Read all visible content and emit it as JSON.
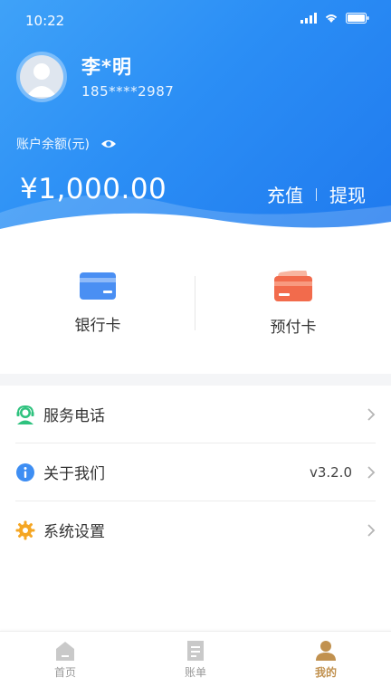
{
  "status_bar": {
    "time": "10:22"
  },
  "user": {
    "name": "李*明",
    "phone": "185****2987"
  },
  "balance": {
    "label": "账户余额(元)",
    "amount": "¥1,000.00"
  },
  "actions": {
    "recharge": "充值",
    "withdraw": "提现"
  },
  "cards": [
    {
      "label": "银行卡",
      "icon": "bank-card-icon",
      "color": "#4a8ff3"
    },
    {
      "label": "预付卡",
      "icon": "prepaid-card-icon",
      "color": "#f26b4c"
    }
  ],
  "menu": [
    {
      "label": "服务电话",
      "icon": "customer-service-icon",
      "value": ""
    },
    {
      "label": "关于我们",
      "icon": "info-icon",
      "value": "v3.2.0"
    },
    {
      "label": "系统设置",
      "icon": "gear-icon",
      "value": ""
    }
  ],
  "tabs": [
    {
      "label": "首页",
      "icon": "home-icon",
      "active": false
    },
    {
      "label": "账单",
      "icon": "bill-icon",
      "active": false
    },
    {
      "label": "我的",
      "icon": "profile-icon",
      "active": true
    }
  ],
  "colors": {
    "header_blue": "#2b8ef5",
    "active_tab": "#c1914f",
    "divider": "#f4f5f7"
  }
}
